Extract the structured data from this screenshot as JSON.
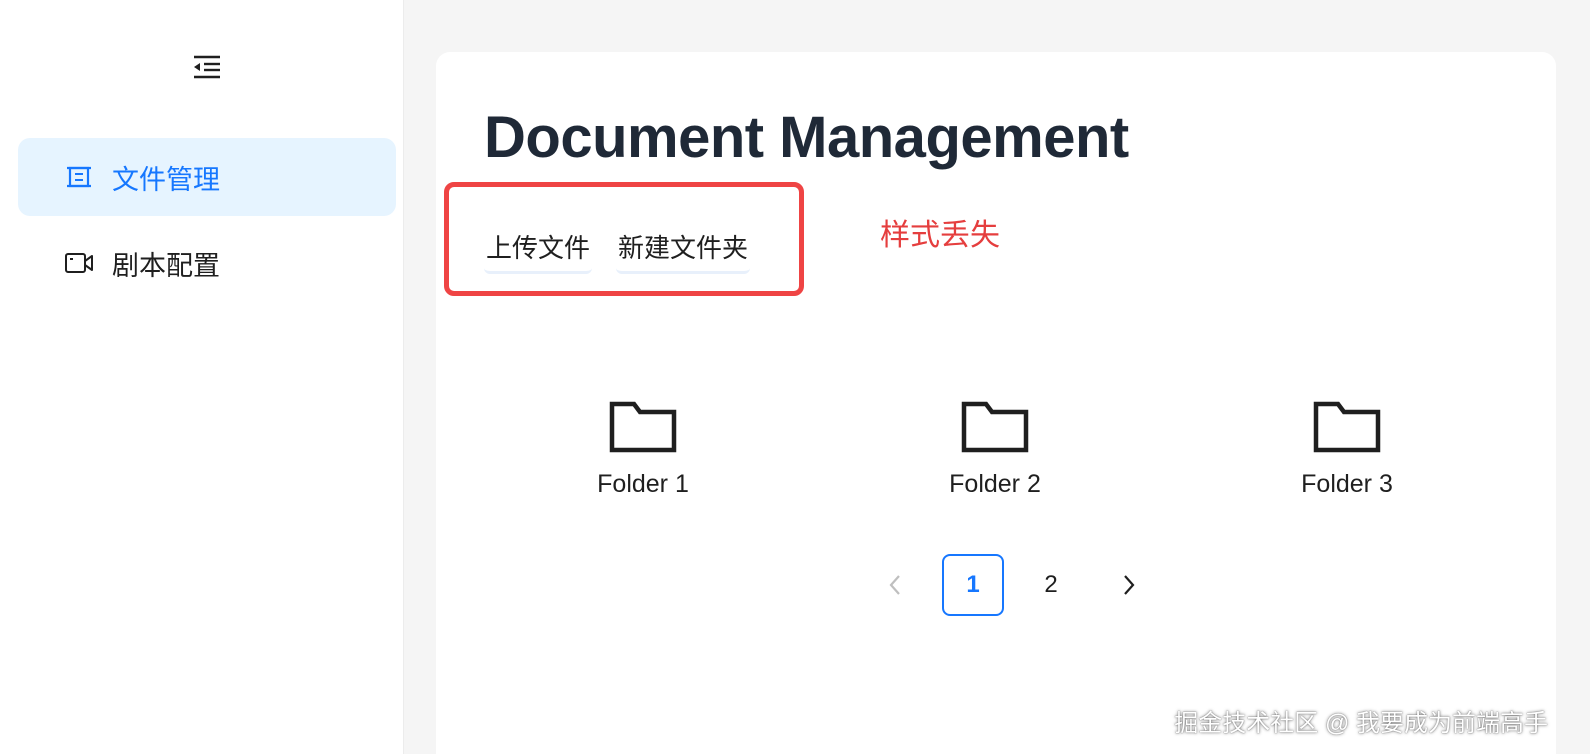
{
  "sidebar": {
    "items": [
      {
        "label": "文件管理",
        "icon": "file-frame-icon",
        "active": true
      },
      {
        "label": "剧本配置",
        "icon": "video-camera-icon",
        "active": false
      }
    ]
  },
  "main": {
    "title": "Document Management",
    "actions": {
      "upload_label": "上传文件",
      "new_folder_label": "新建文件夹"
    },
    "annotation": "样式丢失",
    "folders": [
      {
        "name": "Folder 1"
      },
      {
        "name": "Folder 2"
      },
      {
        "name": "Folder 3"
      }
    ],
    "pagination": {
      "current": "1",
      "pages": [
        "1",
        "2"
      ]
    }
  },
  "watermark": "掘金技术社区 @ 我要成为前端高手",
  "colors": {
    "accent": "#1677ff",
    "active_bg": "#e6f4ff",
    "annotation": "#e53e3e",
    "title": "#1f2937"
  }
}
